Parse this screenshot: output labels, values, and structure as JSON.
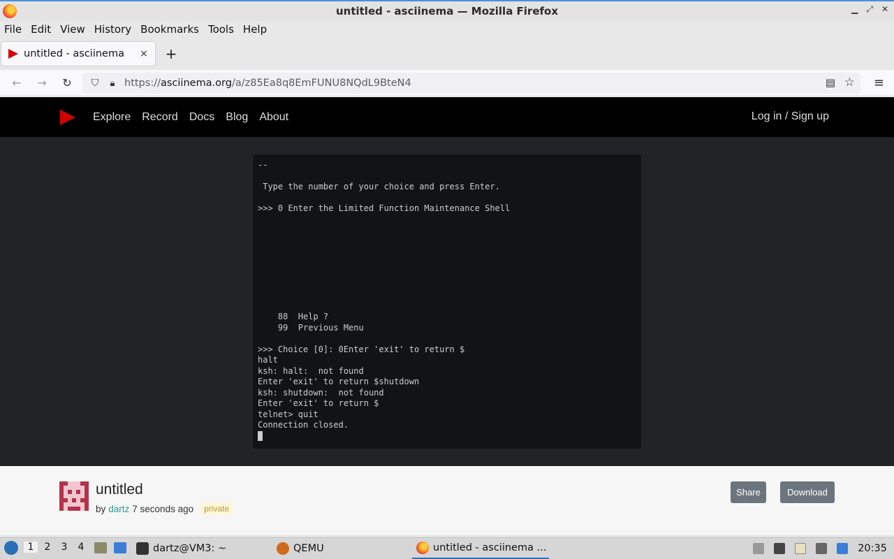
{
  "window": {
    "title": "untitled - asciinema — Mozilla Firefox"
  },
  "menu": [
    "File",
    "Edit",
    "View",
    "History",
    "Bookmarks",
    "Tools",
    "Help"
  ],
  "tab": {
    "label": "untitled - asciinema",
    "close": "×",
    "new_tab": "+"
  },
  "nav": {
    "url_prefix": "https://",
    "url_domain": "asciinema.org",
    "url_path": "/a/z85Ea8q8EmFUNU8NQdL9BteN4"
  },
  "site": {
    "nav_items": [
      "Explore",
      "Record",
      "Docs",
      "Blog",
      "About"
    ],
    "login": "Log in / Sign up"
  },
  "terminal": {
    "lines": [
      "--",
      "",
      " Type the number of your choice and press Enter.",
      "",
      ">>> 0 Enter the Limited Function Maintenance Shell",
      "",
      "",
      "",
      "",
      "",
      "",
      "",
      "",
      "",
      "    88  Help ?",
      "    99  Previous Menu",
      "",
      ">>> Choice [0]: 0Enter 'exit' to return $",
      "halt",
      "ksh: halt:  not found",
      "Enter 'exit' to return $shutdown",
      "ksh: shutdown:  not found",
      "Enter 'exit' to return $",
      "telnet> quit",
      "Connection closed."
    ]
  },
  "recording": {
    "title": "untitled",
    "by": "by",
    "author": "dartz",
    "time": "7 seconds ago",
    "badge": "private",
    "share": "Share",
    "download": "Download"
  },
  "taskbar": {
    "workspaces": [
      "1",
      "2",
      "3",
      "4"
    ],
    "tasks": [
      "dartz@VM3: ~",
      "QEMU",
      "untitled - asciinema ..."
    ],
    "clock": "20:35"
  },
  "colors": {
    "brand_red": "#d40000",
    "header_bg": "#000000",
    "player_bg": "#222326",
    "terminal_bg": "#121314",
    "author_link": "#2a9d8f"
  }
}
